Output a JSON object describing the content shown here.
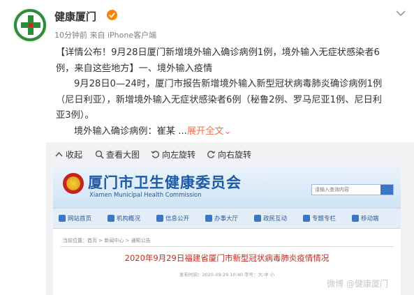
{
  "post": {
    "user_name": "健康厦门",
    "meta": "10分钟前 来自 iPhone客户端",
    "lines": [
      "【详情公布！9月28日厦门新增境外输入确诊病例1例，境外输入无症状感染者6",
      "例，来自这些地方】一、境外输入疫情",
      "9月28日0—24时，厦门市报告新增境外输入新型冠状病毒肺炎确诊病例1例",
      "（尼日利亚），新增境外输入无症状感染者6例（秘鲁2例、罗马尼亚1例、尼日利",
      "亚3例）。"
    ],
    "last_line": "境外输入确诊病例：崔某 ...",
    "expand_label": "展开全文",
    "expand_arrow": "⌄"
  },
  "toolbar": {
    "collapse": "收起",
    "view_large": "查看大图",
    "rotate_left": "向左旋转",
    "rotate_right": "向右旋转"
  },
  "site": {
    "title": "厦门市卫生健康委员会",
    "subtitle": "Xiamen  Municipal Health Commission",
    "search_placeholder": "请输入查询内容",
    "nav": [
      "网站首页",
      "机构概况",
      "信息公开",
      "办事大厅",
      "政民互动",
      "专题专栏",
      "移动端"
    ],
    "crumb": "当前位置：首页 > 新闻中心 > 通知公告",
    "article_title": "2020年9月29日福建省厦门市新型冠状病毒肺炎疫情情况",
    "article_meta": "发布时间：2020-09-29 10:40   字号：大 中 小",
    "watermark": "微博 @健康厦门"
  },
  "colors": {
    "accent": "#eb7350",
    "verified": "#ff8200",
    "site_blue": "#1d5aa6",
    "title_red": "#c12b24"
  },
  "icons": [
    "verified-icon",
    "more-chevron-icon",
    "collapse-icon",
    "zoom-icon",
    "rotate-left-icon",
    "rotate-right-icon"
  ]
}
